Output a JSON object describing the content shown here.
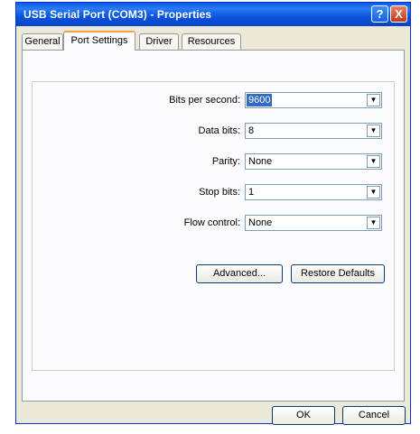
{
  "window": {
    "title": "USB Serial Port (COM3) - Properties",
    "help_glyph": "?",
    "close_glyph": "X"
  },
  "tabs": [
    {
      "label": "General",
      "active": false
    },
    {
      "label": "Port Settings",
      "active": true
    },
    {
      "label": "Driver",
      "active": false
    },
    {
      "label": "Resources",
      "active": false
    }
  ],
  "settings": [
    {
      "label": "Bits per second:",
      "value": "9600"
    },
    {
      "label": "Data bits:",
      "value": "8"
    },
    {
      "label": "Parity:",
      "value": "None"
    },
    {
      "label": "Stop bits:",
      "value": "1"
    },
    {
      "label": "Flow control:",
      "value": "None"
    }
  ],
  "dropdown_glyph": "▼",
  "buttons": {
    "advanced": "Advanced...",
    "restore": "Restore Defaults",
    "ok": "OK",
    "cancel": "Cancel"
  },
  "colors": {
    "titlebar": "#0a5ae8",
    "dialog_bg": "#ece9d8",
    "selection": "#316ac5"
  }
}
